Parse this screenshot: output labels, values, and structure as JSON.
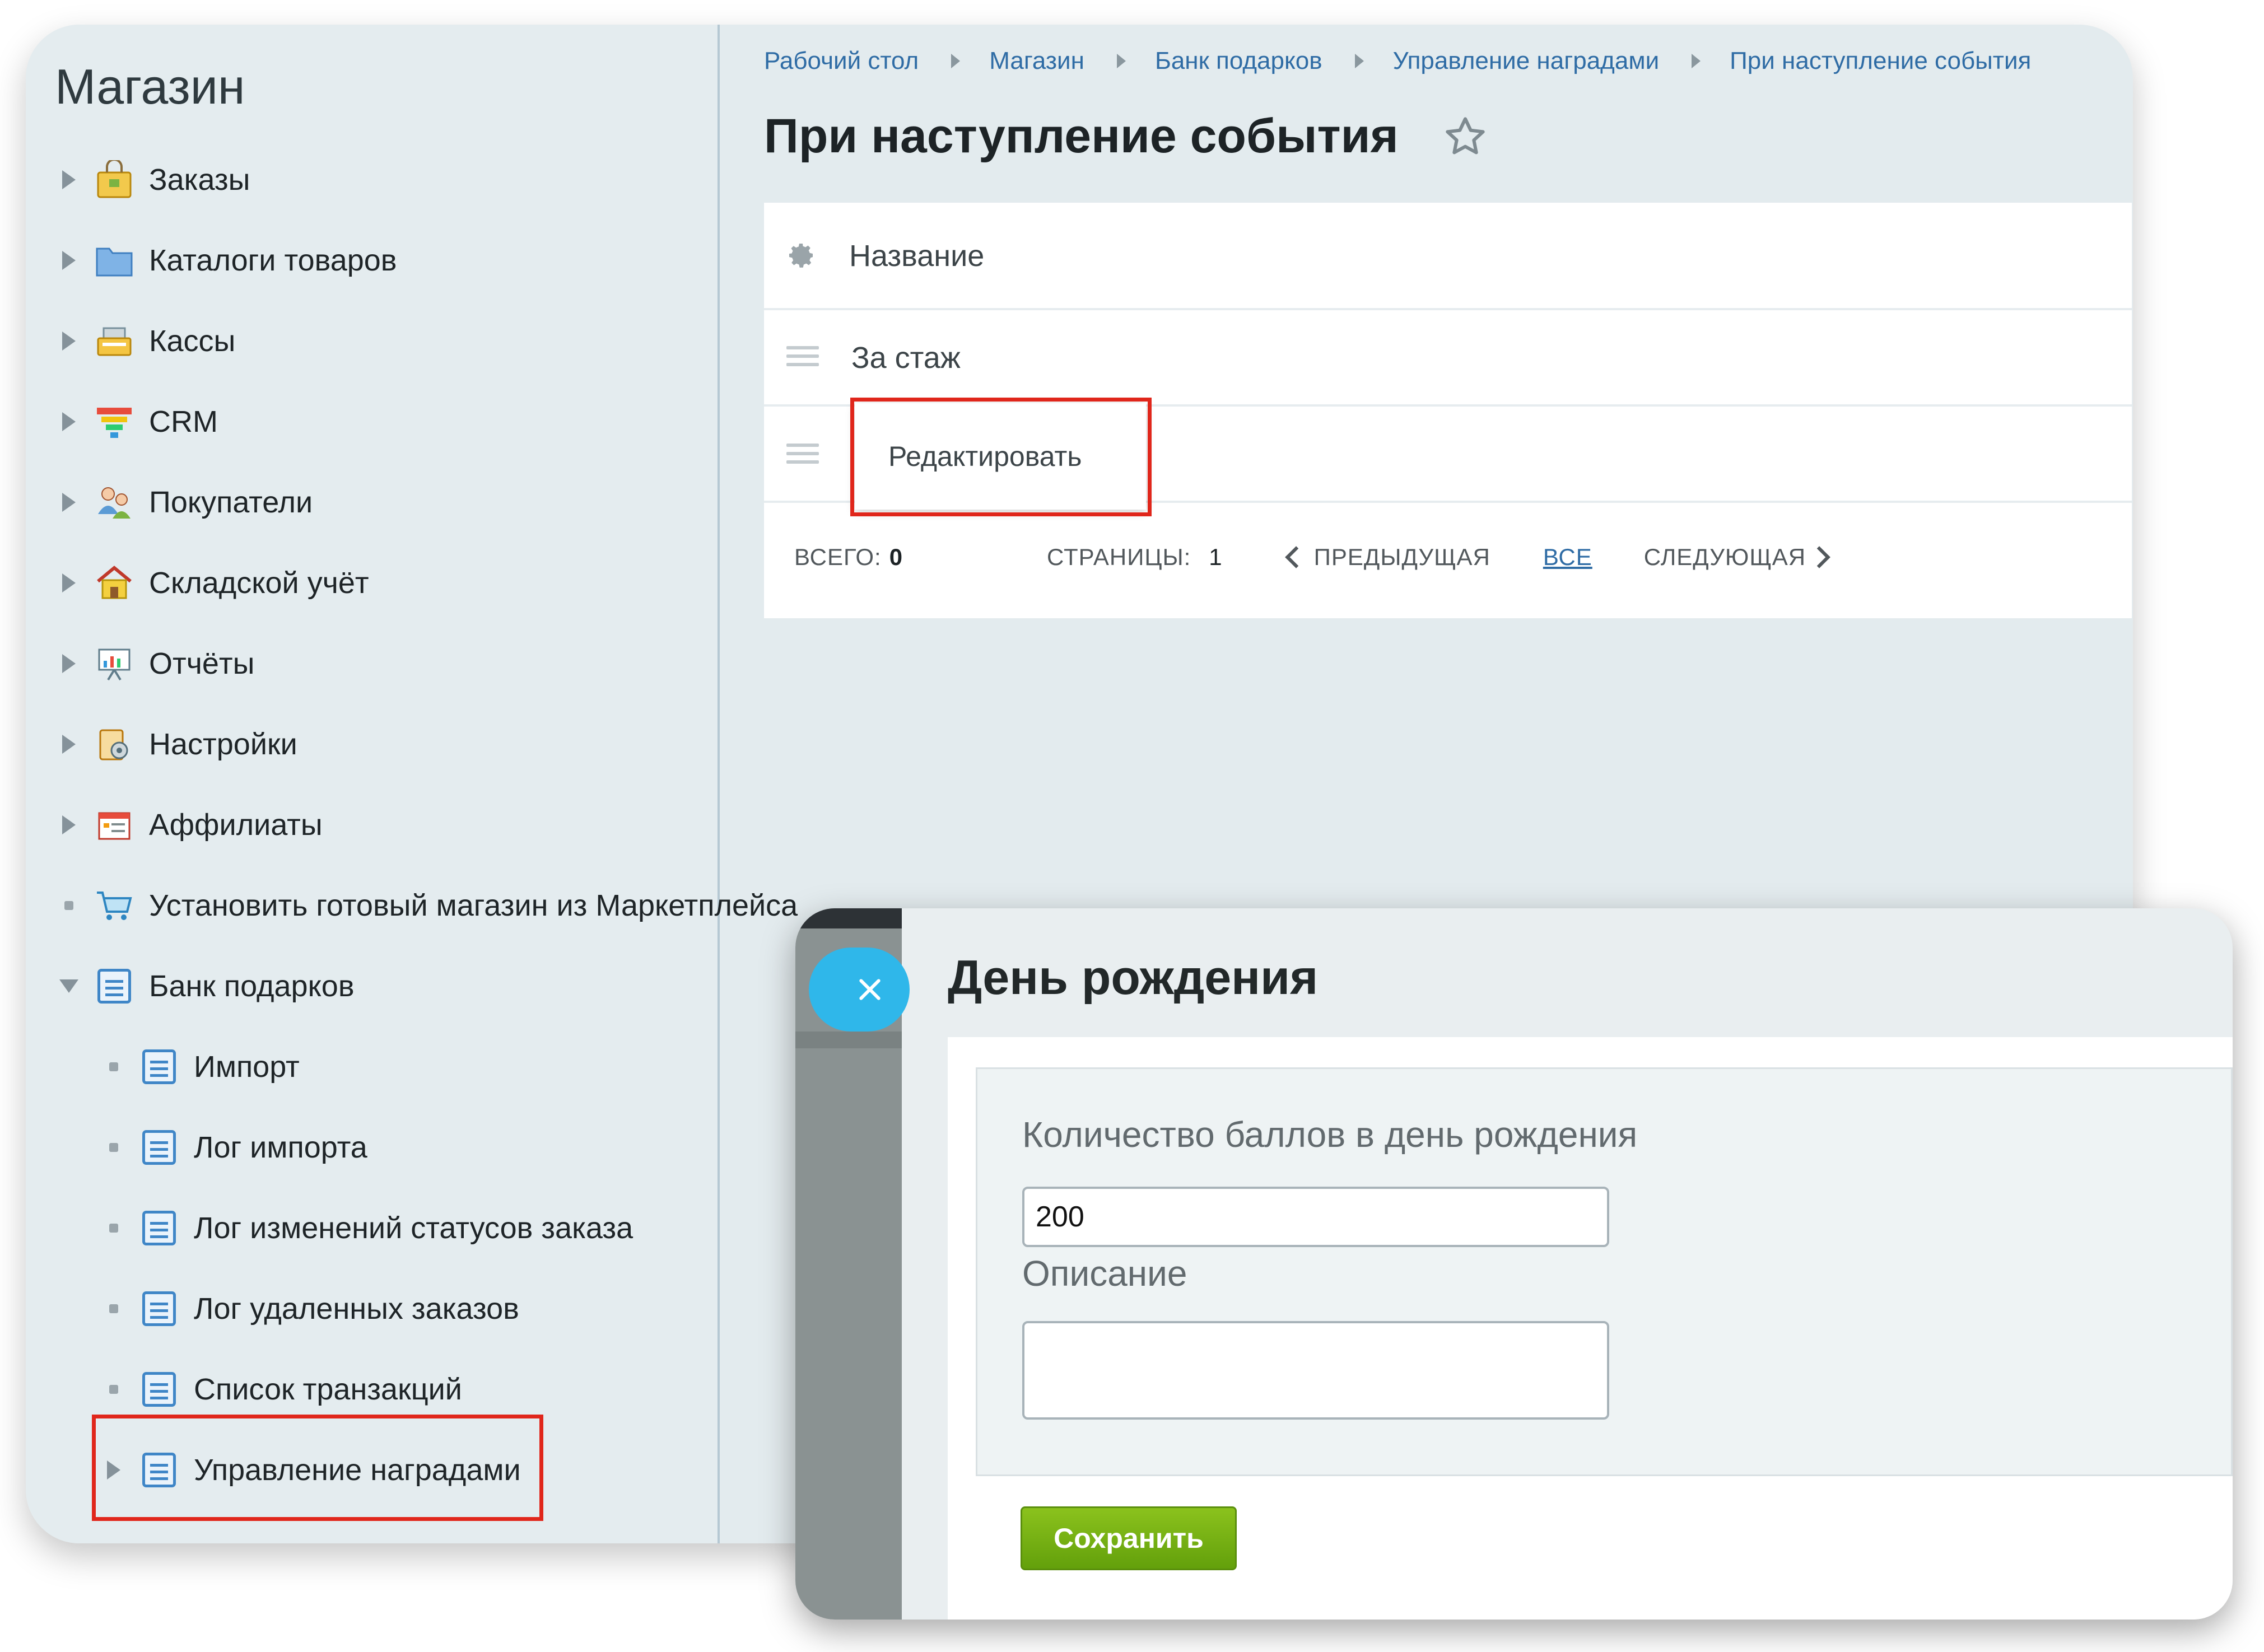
{
  "sidebar": {
    "title": "Магазин",
    "items": [
      {
        "label": "Заказы",
        "icon": "shopping-bag-icon"
      },
      {
        "label": "Каталоги товаров",
        "icon": "folder-icon"
      },
      {
        "label": "Кассы",
        "icon": "cash-register-icon"
      },
      {
        "label": "CRM",
        "icon": "funnel-icon"
      },
      {
        "label": "Покупатели",
        "icon": "users-icon"
      },
      {
        "label": "Складской учёт",
        "icon": "warehouse-icon"
      },
      {
        "label": "Отчёты",
        "icon": "report-board-icon"
      },
      {
        "label": "Настройки",
        "icon": "settings-clipboard-icon"
      },
      {
        "label": "Аффилиаты",
        "icon": "affiliate-icon"
      },
      {
        "label": "Установить готовый магазин из Маркетплейса",
        "icon": "cart-icon"
      },
      {
        "label": "Банк подарков",
        "icon": "document-icon"
      }
    ],
    "subitems": [
      {
        "label": "Импорт"
      },
      {
        "label": "Лог импорта"
      },
      {
        "label": "Лог изменений статусов заказа"
      },
      {
        "label": "Лог удаленных заказов"
      },
      {
        "label": "Список транзакций"
      },
      {
        "label": "Управление наградами"
      }
    ]
  },
  "breadcrumb": [
    "Рабочий стол",
    "Магазин",
    "Банк подарков",
    "Управление наградами",
    "При наступление события"
  ],
  "page_title": "При наступление события",
  "grid": {
    "header": "Название",
    "rows": [
      "За стаж"
    ],
    "context_menu": {
      "edit": "Редактировать"
    }
  },
  "pager": {
    "total_label": "ВСЕГО:",
    "total_value": "0",
    "pages_label": "СТРАНИЦЫ:",
    "pages_value": "1",
    "prev": "ПРЕДЫДУЩАЯ",
    "all": "ВСЕ",
    "next": "СЛЕДУЮЩАЯ"
  },
  "modal": {
    "title": "День рождения",
    "fields": {
      "points_label": "Количество баллов в день рождения",
      "points_value": "200",
      "description_label": "Описание",
      "description_value": ""
    },
    "save_label": "Сохранить"
  },
  "colors": {
    "accent_link": "#2f6ca5",
    "highlight_red": "#e0261b",
    "save_green": "#7bb314",
    "close_blue": "#2fb7ea"
  }
}
